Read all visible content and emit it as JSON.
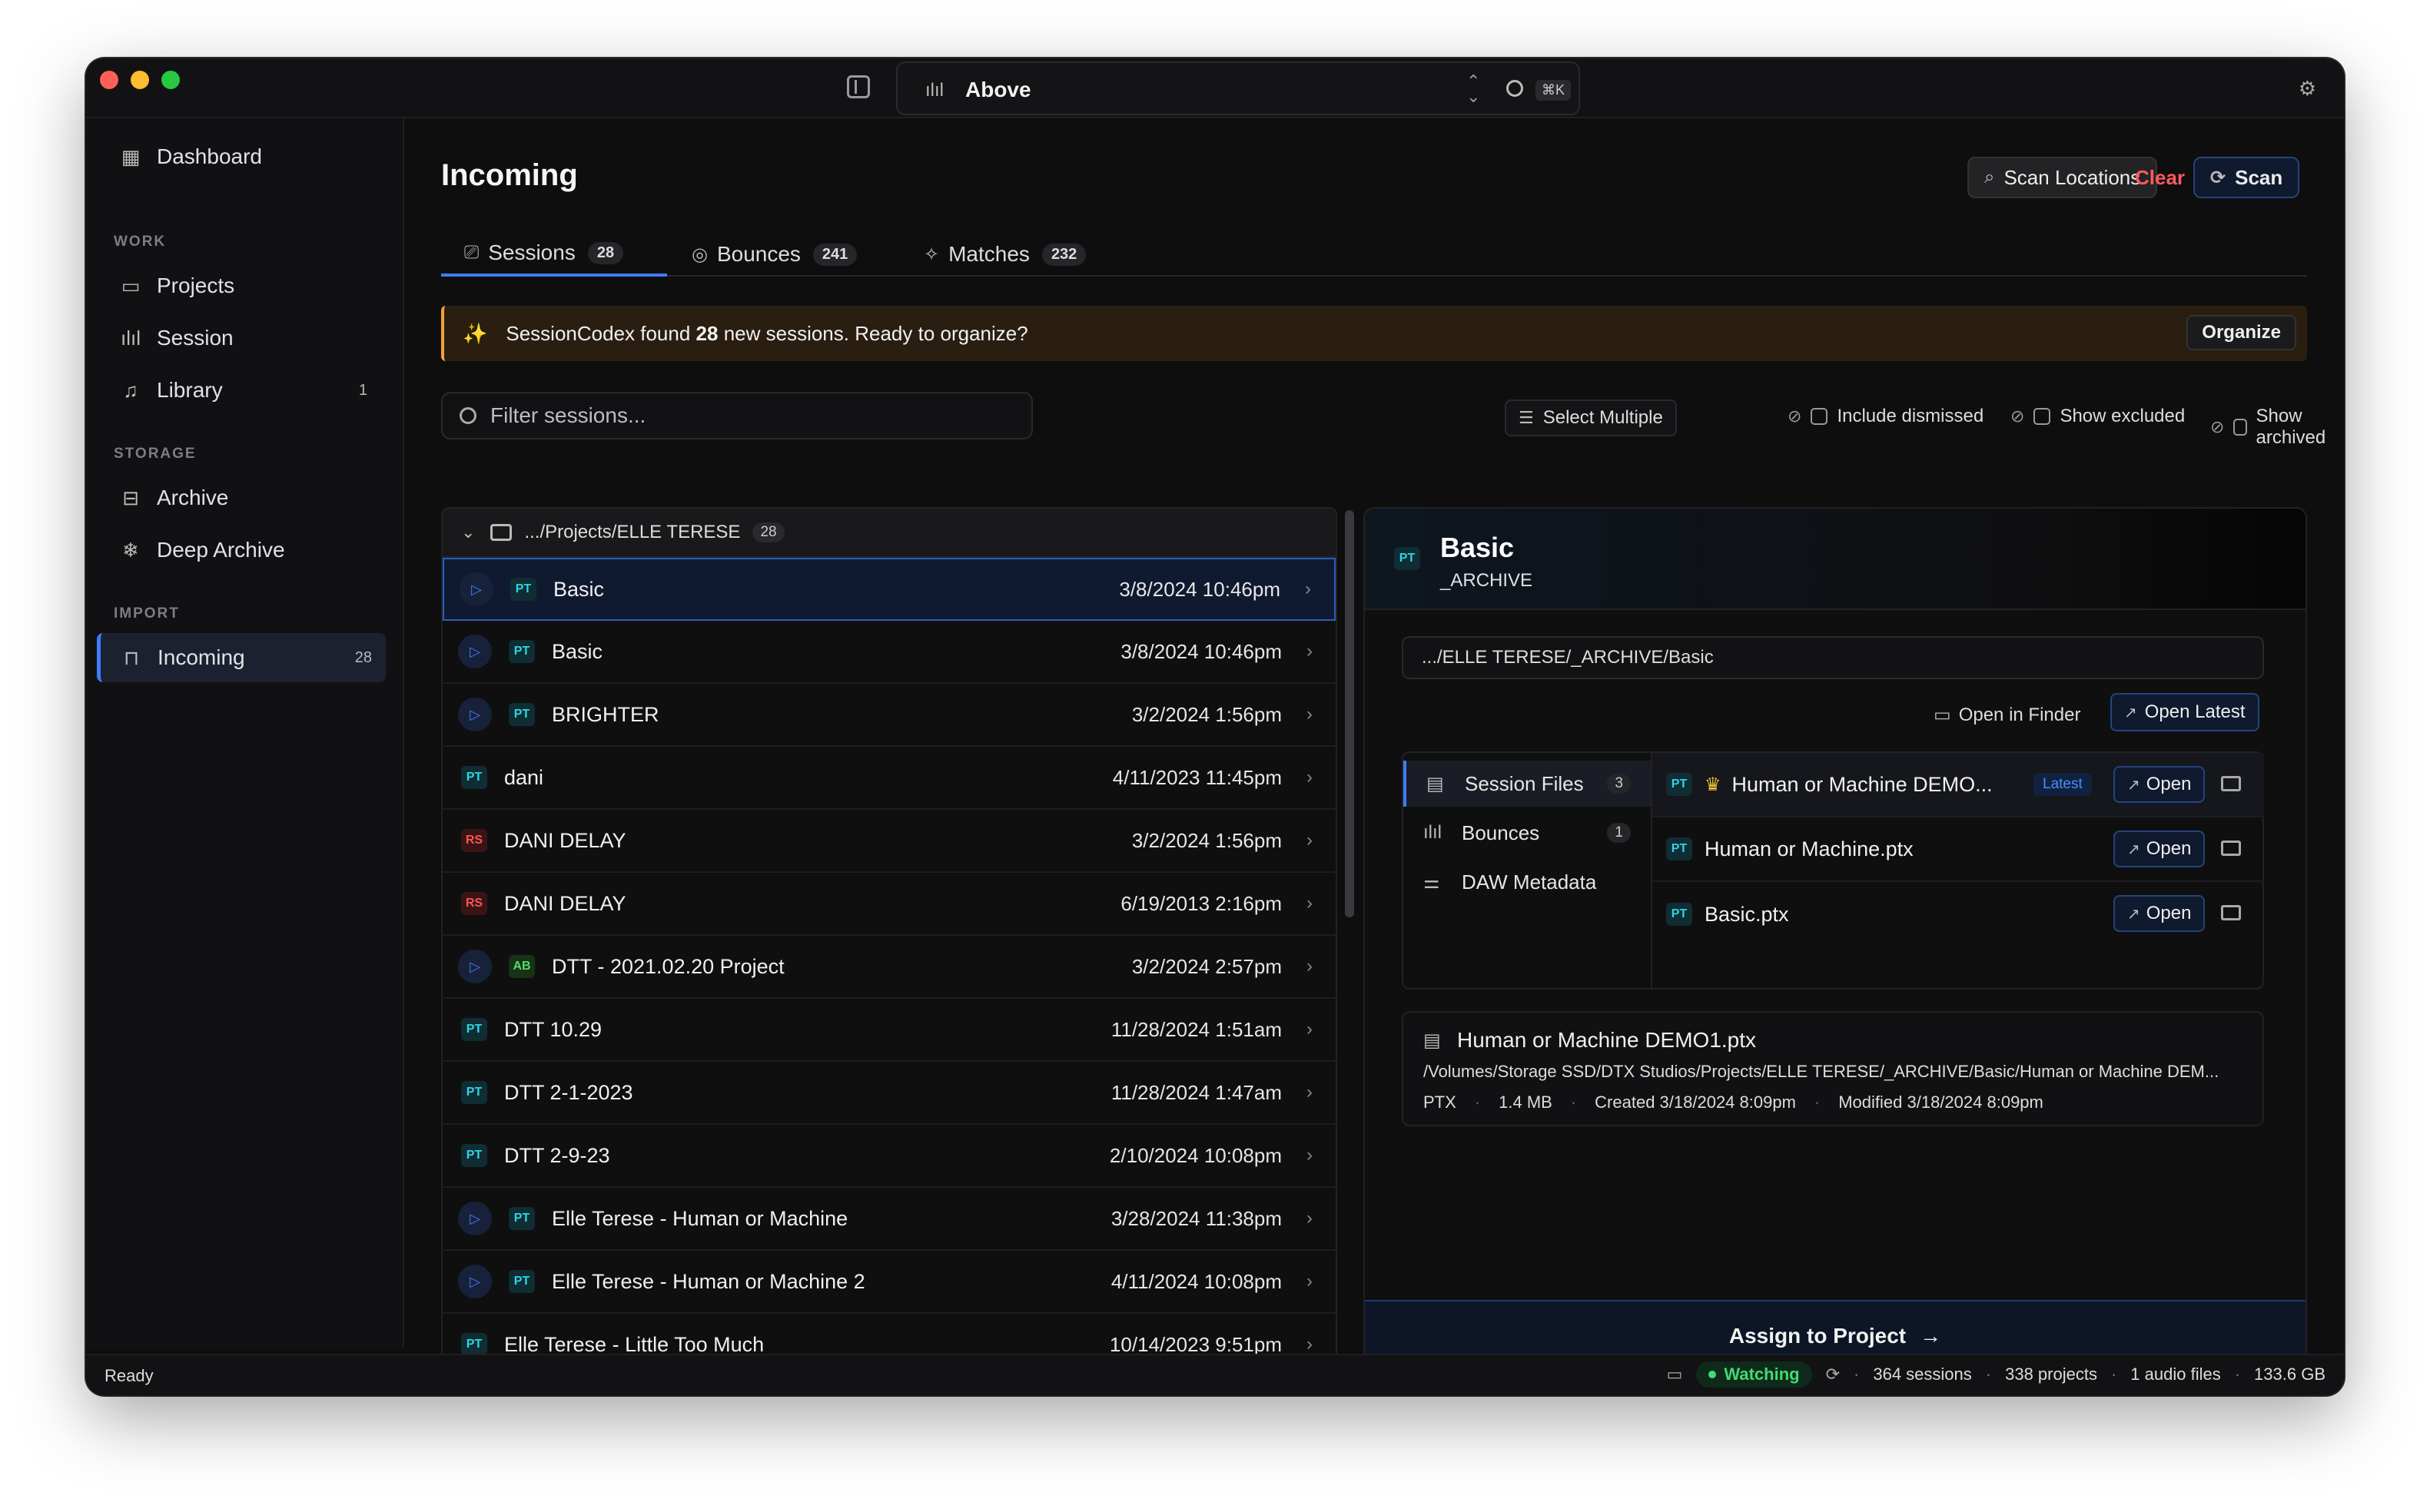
{
  "titlebar": {
    "selector_label": "Above",
    "shortcut": "⌘K"
  },
  "sidebar": {
    "items": [
      {
        "label": "Dashboard",
        "icon": "dashboard-icon"
      },
      {
        "label": "Projects",
        "icon": "folder-icon"
      },
      {
        "label": "Session",
        "icon": "waveform-icon"
      },
      {
        "label": "Library",
        "icon": "music-note-icon",
        "count": "1"
      },
      {
        "label": "Archive",
        "icon": "archive-icon"
      },
      {
        "label": "Deep Archive",
        "icon": "snowflake-icon"
      },
      {
        "label": "Incoming",
        "icon": "inbox-icon",
        "count": "28"
      }
    ],
    "sections": {
      "work": "WORK",
      "storage": "STORAGE",
      "import": "IMPORT"
    }
  },
  "header": {
    "title": "Incoming",
    "scan_locations": "Scan Locations",
    "clear": "Clear",
    "scan": "Scan"
  },
  "tabs": [
    {
      "label": "Sessions",
      "count": "28"
    },
    {
      "label": "Bounces",
      "count": "241"
    },
    {
      "label": "Matches",
      "count": "232"
    }
  ],
  "banner": {
    "prefix": "SessionCodex found ",
    "count": "28",
    "suffix": " new sessions. Ready to organize?",
    "action": "Organize"
  },
  "filter": {
    "placeholder": "Filter sessions..."
  },
  "options": {
    "select_multiple": "Select Multiple",
    "include_dismissed": "Include dismissed",
    "show_excluded": "Show excluded",
    "show_archived": "Show archived"
  },
  "group": {
    "path": ".../Projects/ELLE TERESE",
    "count": "28"
  },
  "sessions": [
    {
      "name": "Basic",
      "tag": "PT",
      "date": "3/8/2024 10:46pm",
      "play": true,
      "selected": true
    },
    {
      "name": "Basic",
      "tag": "PT",
      "date": "3/8/2024 10:46pm",
      "play": true
    },
    {
      "name": "BRIGHTER",
      "tag": "PT",
      "date": "3/2/2024 1:56pm",
      "play": true
    },
    {
      "name": "dani",
      "tag": "PT",
      "date": "4/11/2023 11:45pm",
      "play": false
    },
    {
      "name": "DANI DELAY",
      "tag": "RS",
      "date": "3/2/2024 1:56pm",
      "play": false
    },
    {
      "name": "DANI DELAY",
      "tag": "RS",
      "date": "6/19/2013 2:16pm",
      "play": false
    },
    {
      "name": "DTT - 2021.02.20 Project",
      "tag": "AB",
      "date": "3/2/2024 2:57pm",
      "play": true
    },
    {
      "name": "DTT 10.29",
      "tag": "PT",
      "date": "11/28/2024 1:51am",
      "play": false
    },
    {
      "name": "DTT 2-1-2023",
      "tag": "PT",
      "date": "11/28/2024 1:47am",
      "play": false
    },
    {
      "name": "DTT 2-9-23",
      "tag": "PT",
      "date": "2/10/2024 10:08pm",
      "play": false
    },
    {
      "name": "Elle Terese - Human or Machine",
      "tag": "PT",
      "date": "3/28/2024 11:38pm",
      "play": true
    },
    {
      "name": "Elle Terese - Human or Machine 2",
      "tag": "PT",
      "date": "4/11/2024 10:08pm",
      "play": true
    },
    {
      "name": "Elle Terese - Little Too Much",
      "tag": "PT",
      "date": "10/14/2023 9:51pm",
      "play": false
    }
  ],
  "detail": {
    "tag": "PT",
    "title": "Basic",
    "subtitle": "_ARCHIVE",
    "path": ".../ELLE TERESE/_ARCHIVE/Basic",
    "open_in_finder": "Open in Finder",
    "open_latest": "Open Latest",
    "nav": [
      {
        "label": "Session Files",
        "count": "3"
      },
      {
        "label": "Bounces",
        "count": "1"
      },
      {
        "label": "DAW Metadata"
      }
    ],
    "files": [
      {
        "tag": "PT",
        "name": "Human or Machine DEMO...",
        "latest": "Latest",
        "open": "Open"
      },
      {
        "tag": "PT",
        "name": "Human or Machine.ptx",
        "open": "Open"
      },
      {
        "tag": "PT",
        "name": "Basic.ptx",
        "open": "Open"
      }
    ],
    "file_info": {
      "name": "Human or Machine DEMO1.ptx",
      "path": "/Volumes/Storage SSD/DTX Studios/Projects/ELLE TERESE/_ARCHIVE/Basic/Human or Machine DEM...",
      "type": "PTX",
      "size": "1.4 MB",
      "created": "Created 3/18/2024 8:09pm",
      "modified": "Modified 3/18/2024 8:09pm"
    },
    "assign": "Assign to Project"
  },
  "status": {
    "ready": "Ready",
    "watching": "Watching",
    "sessions": "364 sessions",
    "projects": "338 projects",
    "audio_files": "1 audio files",
    "size": "133.6 GB"
  },
  "colors": {
    "accent": "#3f7cff",
    "danger": "#ff5a5a",
    "warning": "#f0a23a",
    "success": "#3fdc74"
  }
}
